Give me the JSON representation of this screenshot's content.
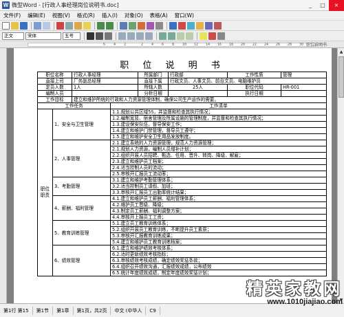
{
  "window": {
    "title": "微型Word - [行政人事经理岗位说明书.doc]",
    "app_icon_letter": "W",
    "minimize": "_",
    "maximize": "□",
    "close": "×"
  },
  "menu": [
    "文件(F)",
    "编辑(E)",
    "视图(V)",
    "格式(R)",
    "插入(I)",
    "对象(O)",
    "表格(A)",
    "窗口(W)"
  ],
  "toolbar": {
    "style_combo": "正文",
    "font_combo": "宋体",
    "size_combo": "五号"
  },
  "ruler": {
    "marks": [
      "6",
      "4",
      "2",
      "2",
      "4",
      "6",
      "8",
      "10",
      "12",
      "14",
      "16",
      "18",
      "20",
      "22",
      "24",
      "26",
      "28",
      "30",
      "32",
      "34",
      "36",
      "38",
      "40",
      "42",
      "44"
    ],
    "tab_label": "职位说明书"
  },
  "doc": {
    "title": "职 位 说 明 书",
    "h_pos_name": "职位名称",
    "pos_name": "行政人事经理",
    "h_dept": "所属部门",
    "dept": "行政部",
    "h_nature": "工作性质",
    "nature": "管理",
    "h_superior": "直接上司",
    "superior": "厂务副总经理",
    "h_subordinate": "直接下属",
    "subordinate": "行政文员、人事文员、前台文员、电脑维护员",
    "h_headcount": "定员人数",
    "headcount": "1人",
    "h_dept_count": "所辖人数",
    "dept_count": "25人",
    "h_code": "职位代码",
    "code": "HR-001",
    "h_prepared": "编制人员",
    "h_analysis_date": "分析日期",
    "h_exec_date": "执行日期",
    "h_goal": "工作目标",
    "goal": "建立和维护所统的行政和人力资源管理体制，确保公司生产运作的需要。",
    "h_tasks": "工作任务",
    "h_list": "工作清单",
    "h_duty": "职位职责",
    "groups": [
      {
        "name": "1、安全与卫生管理",
        "items": [
          "1.1.规划公共区域5S，并监督和检查其执行情况；",
          "1.2.编制宽篮、宿舍管理及所属设施的管理制度，并监督和检查其执行情况；",
          "1.3.建设保安队伍，督导保安工作；",
          "1.4.建立和维护门禁管理，督导员工遵守；",
          "1.5.建立和维护安全卫生用品发放制度。"
        ]
      },
      {
        "name": "2、人事管理",
        "items": [
          "2.1.建立系统的人力资源管理，规范人力资源管理；",
          "2.1.规划人力资源，编制人员增补计划；",
          "2.2.组织开展人员招聘、甄选、任用、晋升、转岗、降级、解雇；",
          "2.3.建立和维护员工档案；",
          "2.4.适当控制人员的流动；",
          "2.5.审核开汇报员工流动率；"
        ]
      },
      {
        "name": "3、考勤管理",
        "items": [
          "3.1.建立和维护考勤管理体系；",
          "3.2.适当控制员工请假、加班；",
          "3.3.审核开汇报员工出勤率统计结果；"
        ]
      },
      {
        "name": "4、薪酬、福利管理",
        "items": [
          "4.1.建立和维护员工薪酬、福利管理体系；",
          "4.2.维护员工晋级、降级；",
          "4.3.制定员工薪酬、福利调整方案；",
          "4.4.审核开上报员工工资；"
        ]
      },
      {
        "name": "5、教育训练管理",
        "items": [
          "5.1.建立员工教育训练体系；",
          "5.2.组织开展员工教育训练，不断提升员工素质；",
          "5.3.审核开汇报教育训练成果；",
          "5.4.建立和维护员工教育训练档案；"
        ]
      },
      {
        "name": "6、绩效管理",
        "items": [
          "6.1.建立和维护绩效考核体系；",
          "6.2.适时更新绩效考核指标；",
          "6.3.审核绩效考核成绩，确定绩效奖惩条款；",
          "6.4.组织召开绩效沟通，汇报绩效成绩，公布绩效",
          "6.5.统计年度绩效成绩，制定年度绩效奖惩计划；"
        ]
      }
    ]
  },
  "status": {
    "page_section": "第1行 第15",
    "section": "第1节",
    "chapter": "第1章",
    "page_count": "第1页，共2页",
    "lang": "中文 (中华人",
    "col": "C9"
  },
  "watermark": {
    "big": "精英家教网",
    "small": "www.1010jiajiao.com"
  },
  "colors": {
    "accent": "#2b579a",
    "close": "#e81123"
  }
}
